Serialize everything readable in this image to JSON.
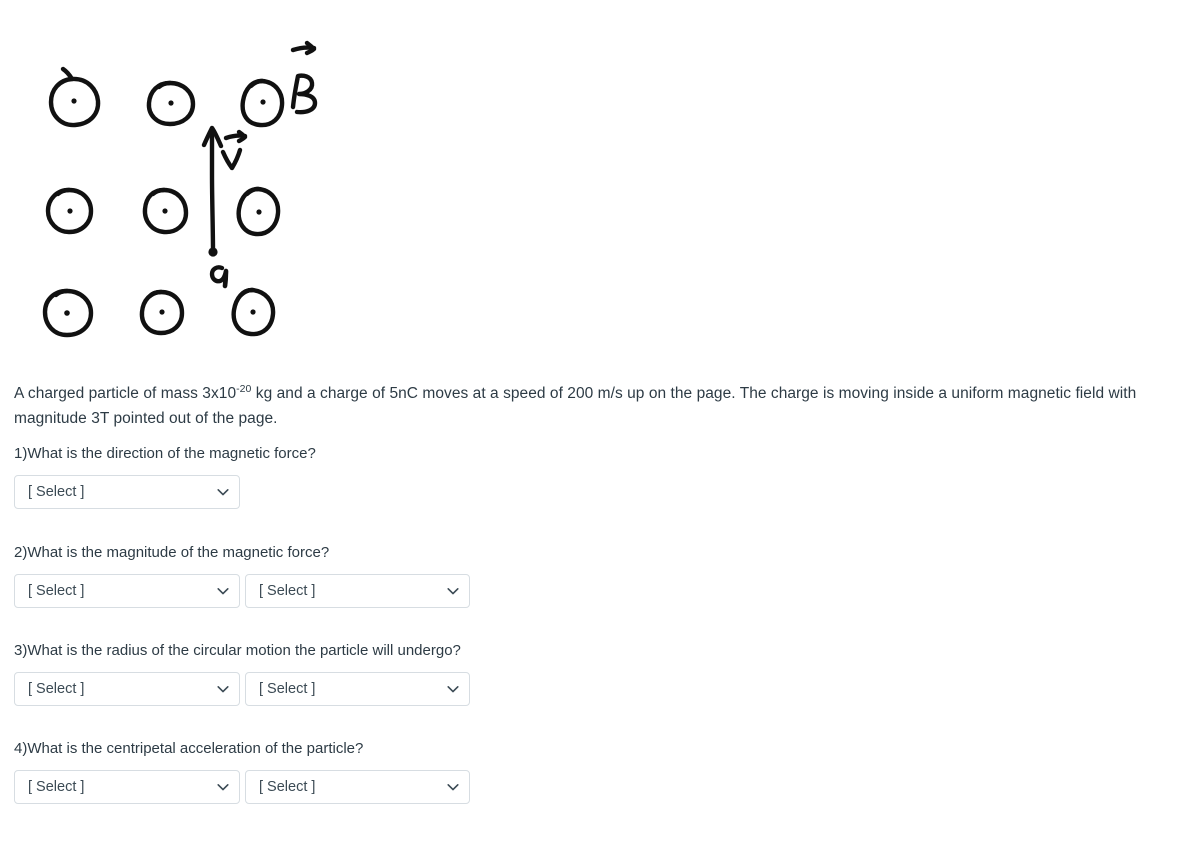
{
  "figure": {
    "name": "magnetic-field-diagram",
    "description": "Hand drawn diagram: 3 by 3 grid of circles with center dots representing a uniform magnetic field pointing out of the page, a vertical upward velocity arrow, a charge dot at its base.",
    "labels": {
      "field": "B",
      "velocity": "v",
      "charge": "q"
    },
    "field_symbol_count": 9,
    "field_direction": "out of page",
    "velocity_direction": "up",
    "stroke_color": "#111111"
  },
  "problem": {
    "part1": "A charged particle of mass 3x10",
    "exponent": "-20",
    "part2": " kg and a charge of 5nC moves at a speed of 200 m/s up on the page. The charge is moving inside a uniform magnetic field with magnitude 3T pointed out of the page."
  },
  "questions": [
    {
      "label": "1)What is the direction of the magnetic force?",
      "selects": [
        {
          "value": "[ Select ]"
        }
      ]
    },
    {
      "label": "2)What is the magnitude of the magnetic force?",
      "selects": [
        {
          "value": "[ Select ]"
        },
        {
          "value": "[ Select ]"
        }
      ]
    },
    {
      "label": "3)What is the radius of the circular motion the particle will undergo?",
      "selects": [
        {
          "value": "[ Select ]"
        },
        {
          "value": "[ Select ]"
        }
      ]
    },
    {
      "label": "4)What is the centripetal acceleration of the particle?",
      "selects": [
        {
          "value": "[ Select ]"
        },
        {
          "value": "[ Select ]"
        }
      ]
    }
  ],
  "icons": {
    "chevron": "chevron-down-icon"
  },
  "colors": {
    "text": "#2d3b45",
    "border": "#d7dde2",
    "background": "#ffffff",
    "ink": "#111111"
  }
}
